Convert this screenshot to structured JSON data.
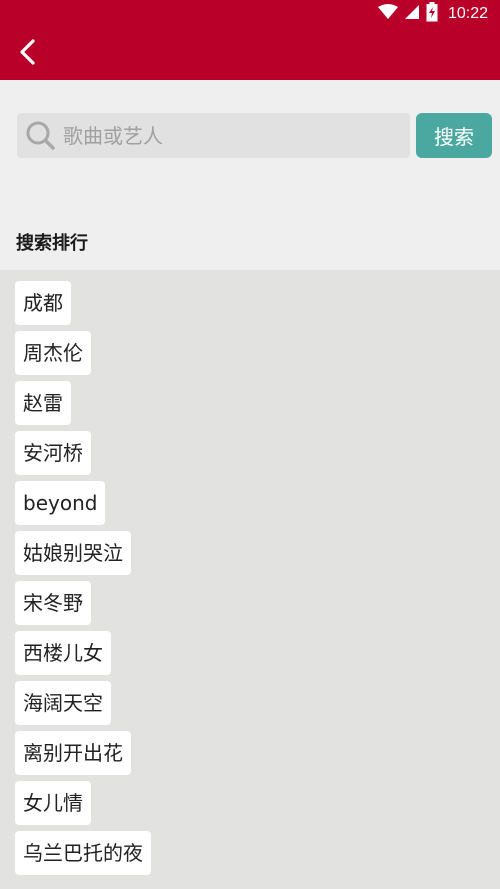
{
  "status_bar": {
    "time": "10:22",
    "icons": [
      "wifi-icon",
      "cell-signal-icon",
      "battery-charging-icon"
    ]
  },
  "header": {
    "back_icon": "chevron-left-icon",
    "colors": {
      "background": "#b80028"
    }
  },
  "search": {
    "placeholder": "歌曲或艺人",
    "value": "",
    "button_label": "搜索",
    "icon": "search-icon",
    "colors": {
      "button": "#4aa8a0"
    }
  },
  "ranking": {
    "title": "搜索排行",
    "items": [
      {
        "label": "成都"
      },
      {
        "label": "周杰伦"
      },
      {
        "label": "赵雷"
      },
      {
        "label": "安河桥"
      },
      {
        "label": "beyond"
      },
      {
        "label": "姑娘别哭泣"
      },
      {
        "label": "宋冬野"
      },
      {
        "label": "西楼儿女"
      },
      {
        "label": "海阔天空"
      },
      {
        "label": "离别开出花"
      },
      {
        "label": "女儿情"
      },
      {
        "label": "乌兰巴托的夜"
      }
    ]
  }
}
